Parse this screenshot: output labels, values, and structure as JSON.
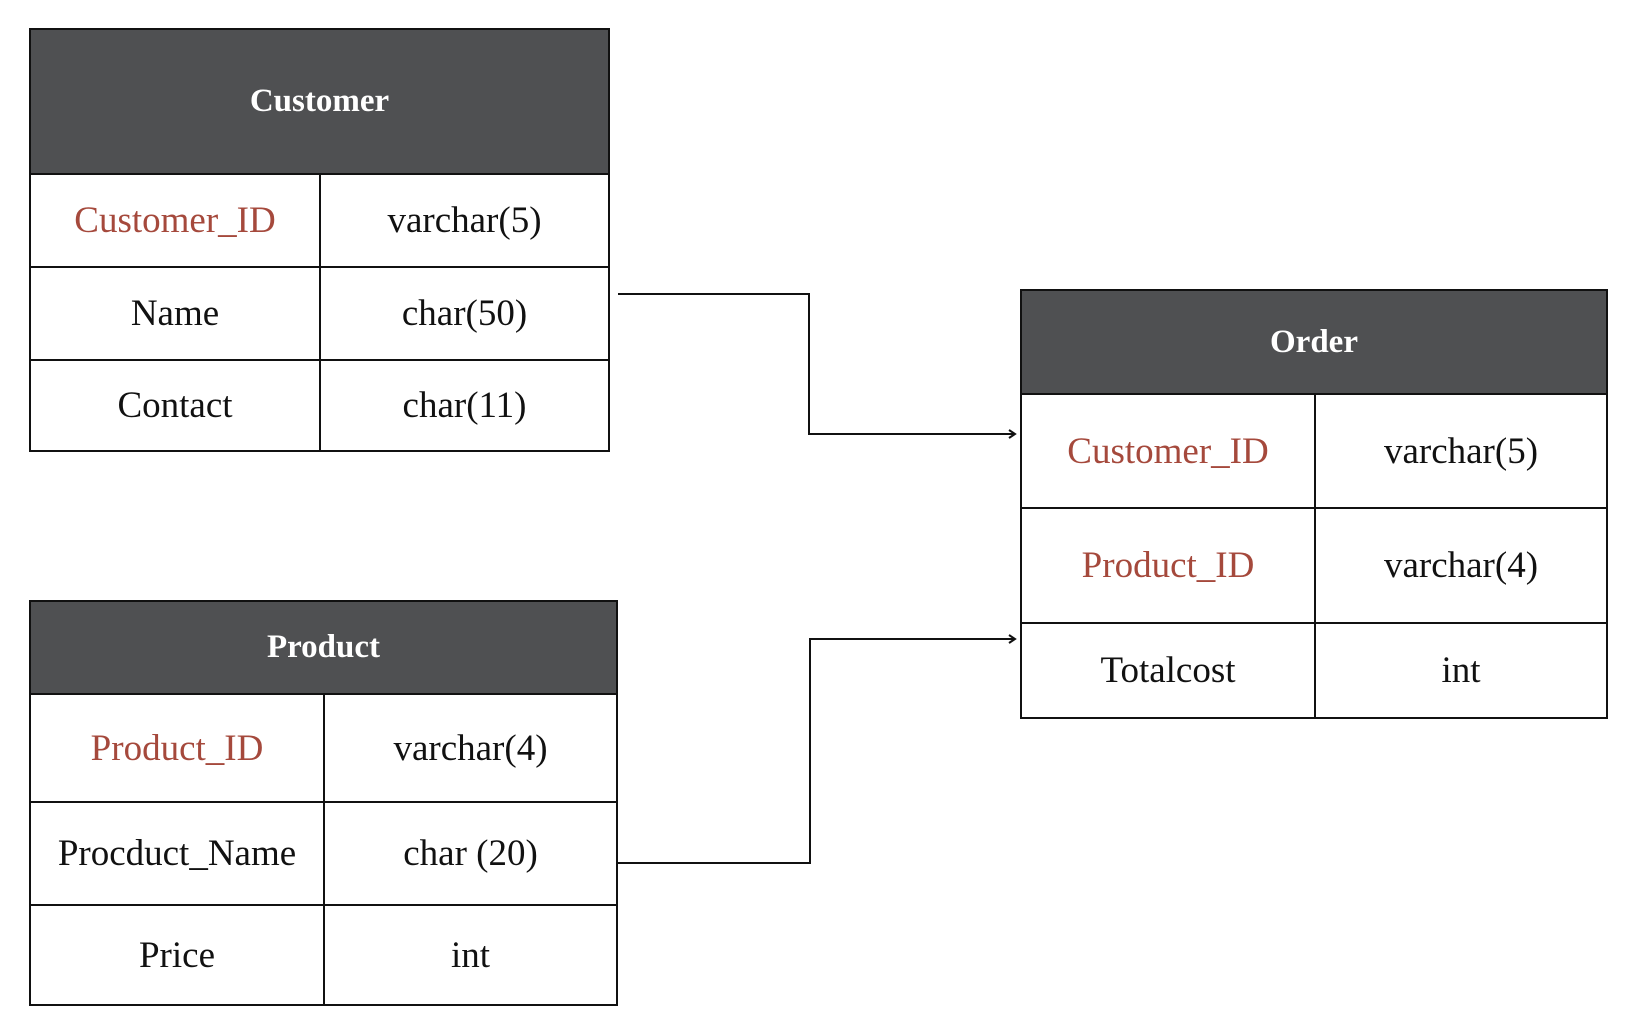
{
  "colors": {
    "header_bg": "#4f5052",
    "key_text": "#a5493c",
    "line": "#111111"
  },
  "tables": {
    "customer": {
      "title": "Customer",
      "rows": [
        {
          "name": "Customer_ID",
          "type": "varchar(5)",
          "key": true
        },
        {
          "name": "Name",
          "type": "char(50)",
          "key": false
        },
        {
          "name": "Contact",
          "type": "char(11)",
          "key": false
        }
      ]
    },
    "product": {
      "title": "Product",
      "rows": [
        {
          "name": "Product_ID",
          "type": "varchar(4)",
          "key": true
        },
        {
          "name": "Procduct_Name",
          "type": "char (20)",
          "key": false
        },
        {
          "name": "Price",
          "type": "int",
          "key": false
        }
      ]
    },
    "order": {
      "title": "Order",
      "rows": [
        {
          "name": "Customer_ID",
          "type": "varchar(5)",
          "key": true
        },
        {
          "name": "Product_ID",
          "type": "varchar(4)",
          "key": true
        },
        {
          "name": "Totalcost",
          "type": "int",
          "key": false
        }
      ]
    }
  },
  "connectors": [
    {
      "from": "customer",
      "to": "order",
      "arrow": "end"
    },
    {
      "from": "product",
      "to": "order",
      "arrow": "end"
    }
  ]
}
